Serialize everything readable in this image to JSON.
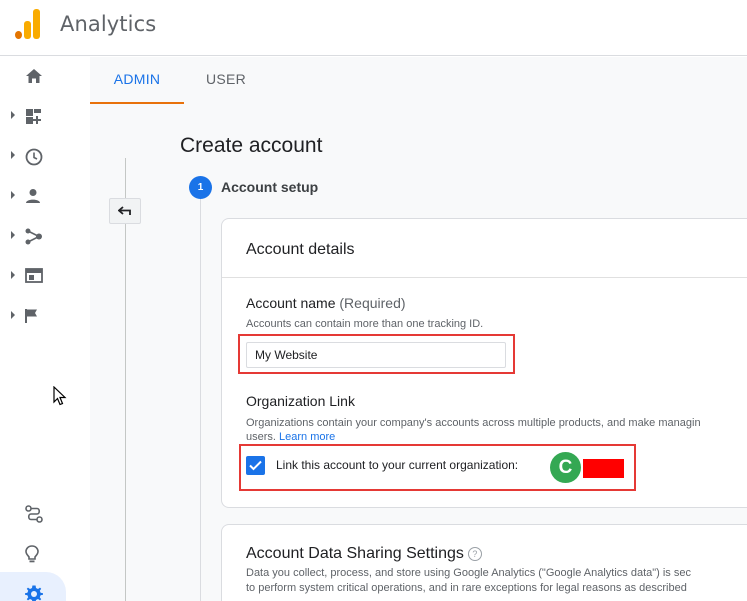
{
  "app": {
    "title": "Analytics",
    "logo_icon": "analytics-logo"
  },
  "colors": {
    "accent": "#1a73e8",
    "tab_underline": "#e8710a",
    "highlight": "#e53935",
    "logo_orange": "#f9ab00",
    "logo_dark": "#e37400",
    "avatar": "#34a853"
  },
  "nav": [
    {
      "icon": "home-icon",
      "expandable": false
    },
    {
      "icon": "dashboard-icon",
      "expandable": true
    },
    {
      "icon": "clock-icon",
      "expandable": true
    },
    {
      "icon": "person-icon",
      "expandable": true
    },
    {
      "icon": "acquisition-icon",
      "expandable": true
    },
    {
      "icon": "behavior-icon",
      "expandable": true
    },
    {
      "icon": "flag-icon",
      "expandable": true
    }
  ],
  "nav_bottom": [
    "route-icon",
    "lightbulb-icon",
    "settings-icon"
  ],
  "tabs": [
    {
      "label": "ADMIN",
      "active": true
    },
    {
      "label": "USER",
      "active": false
    }
  ],
  "page": {
    "title": "Create account",
    "step": {
      "number": "1",
      "label": "Account setup"
    }
  },
  "account_details": {
    "title": "Account details",
    "account_name": {
      "label": "Account name",
      "required": "(Required)",
      "hint": "Accounts can contain more than one tracking ID.",
      "value": "My Website"
    },
    "org_link": {
      "label": "Organization Link",
      "hint_line1": "Organizations contain your company's accounts across multiple products, and make managin",
      "hint_line2": "users.",
      "learn_more": "Learn more",
      "checkbox_label": "Link this account to your current organization:",
      "checked": true,
      "org_initial": "C"
    }
  },
  "data_sharing": {
    "title": "Account Data Sharing Settings",
    "text_line1": "Data you collect, process, and store using Google Analytics (\"Google Analytics data\") is sec",
    "text_line2": "to perform system critical operations, and in rare exceptions for legal reasons as described"
  }
}
